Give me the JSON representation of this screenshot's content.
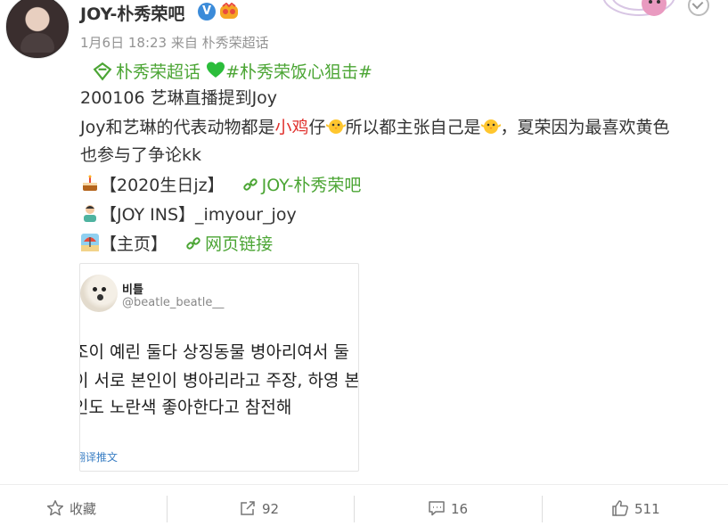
{
  "post": {
    "username": "JOY-朴秀荣吧",
    "verified_badge": "V",
    "meta": "1月6日 18:23 来自 朴秀荣超话",
    "topic_line": {
      "supertopic_icon": "supertopic-diamond-icon",
      "supertopic": "朴秀荣超话",
      "heart_icon": "green-heart-emoji",
      "hashtag": "#朴秀荣饭心狙击#"
    },
    "text_line1": "200106 艺琳直播提到Joy",
    "text_line2_a": "Joy和艺琳的代表动物都是",
    "text_line2_red": "小鸡",
    "text_line2_b": "仔",
    "text_line2_c": "所以都主张自己是",
    "text_line2_d": "，夏荣因为最喜欢黄色",
    "text_line3": "也参与了争论kk",
    "birthday_label": "【2020生日jz】",
    "birthday_link": "JOY-朴秀荣吧",
    "ins_label": "【JOY INS】_imyour_joy",
    "home_label": "【主页】",
    "home_link": "网页链接"
  },
  "embed": {
    "name": "비틀",
    "handle": "@beatle_beatle__",
    "lines": [
      "조이 예린 둘다 상징동물 병아리여서 둘",
      "이 서로 본인이 병아리라고 주장, 하영 본",
      "인도 노란색 좋아한다고 참전해"
    ],
    "translate": "翻译推文"
  },
  "actions": {
    "favorite": "收藏",
    "repost": "92",
    "comment": "16",
    "like": "511"
  },
  "colors": {
    "link_green": "#4ba534",
    "highlight_red": "#e0302c",
    "meta_gray": "#939393"
  }
}
